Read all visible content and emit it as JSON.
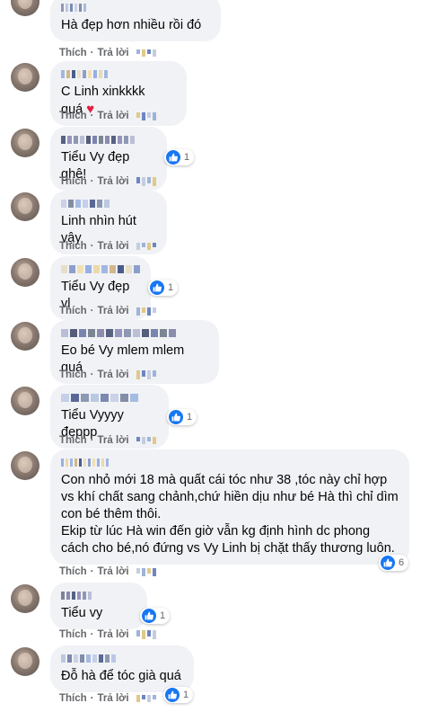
{
  "actions": {
    "like": "Thích",
    "dot": "·",
    "reply": "Trả lời"
  },
  "comments": [
    {
      "text": "Hà đẹp hơn nhiều rồi đó",
      "reactions": ""
    },
    {
      "text": "C Linh xinkkkk quá",
      "reactions": "",
      "emoji": "heart-icon"
    },
    {
      "text": "Tiểu Vy đẹp ghê!",
      "reactions": "1"
    },
    {
      "text": "Linh nhìn hút vậy",
      "reactions": ""
    },
    {
      "text": "Tiểu Vy đẹp vl",
      "reactions": "1"
    },
    {
      "text": "Eo bé Vy mlem mlem quá",
      "reactions": ""
    },
    {
      "text": "Tiểu Vyyyy đẹppp",
      "reactions": "1"
    },
    {
      "text": "Con nhỏ mới 18 mà quất cái tóc như 38 ,tóc này chỉ hợp vs khí chất sang chảnh,chứ hiền dịu như bé Hà thì chỉ dìm con bé thêm thôi.\nEkip từ lúc Hà win đến giờ vẫn kg định hình dc phong cách cho bé,nó đứng vs Vy Linh bị chặt thấy thương luôn.",
      "reactions": "6"
    },
    {
      "text": "Tiểu vy",
      "reactions": "1"
    },
    {
      "text": "Đỗ hà để tóc già quá",
      "reactions": "1"
    }
  ],
  "colors": {
    "bubble": "#f0f2f5",
    "meta": "#65676b",
    "like": "#1877f2",
    "heart": "#e41e3f"
  }
}
